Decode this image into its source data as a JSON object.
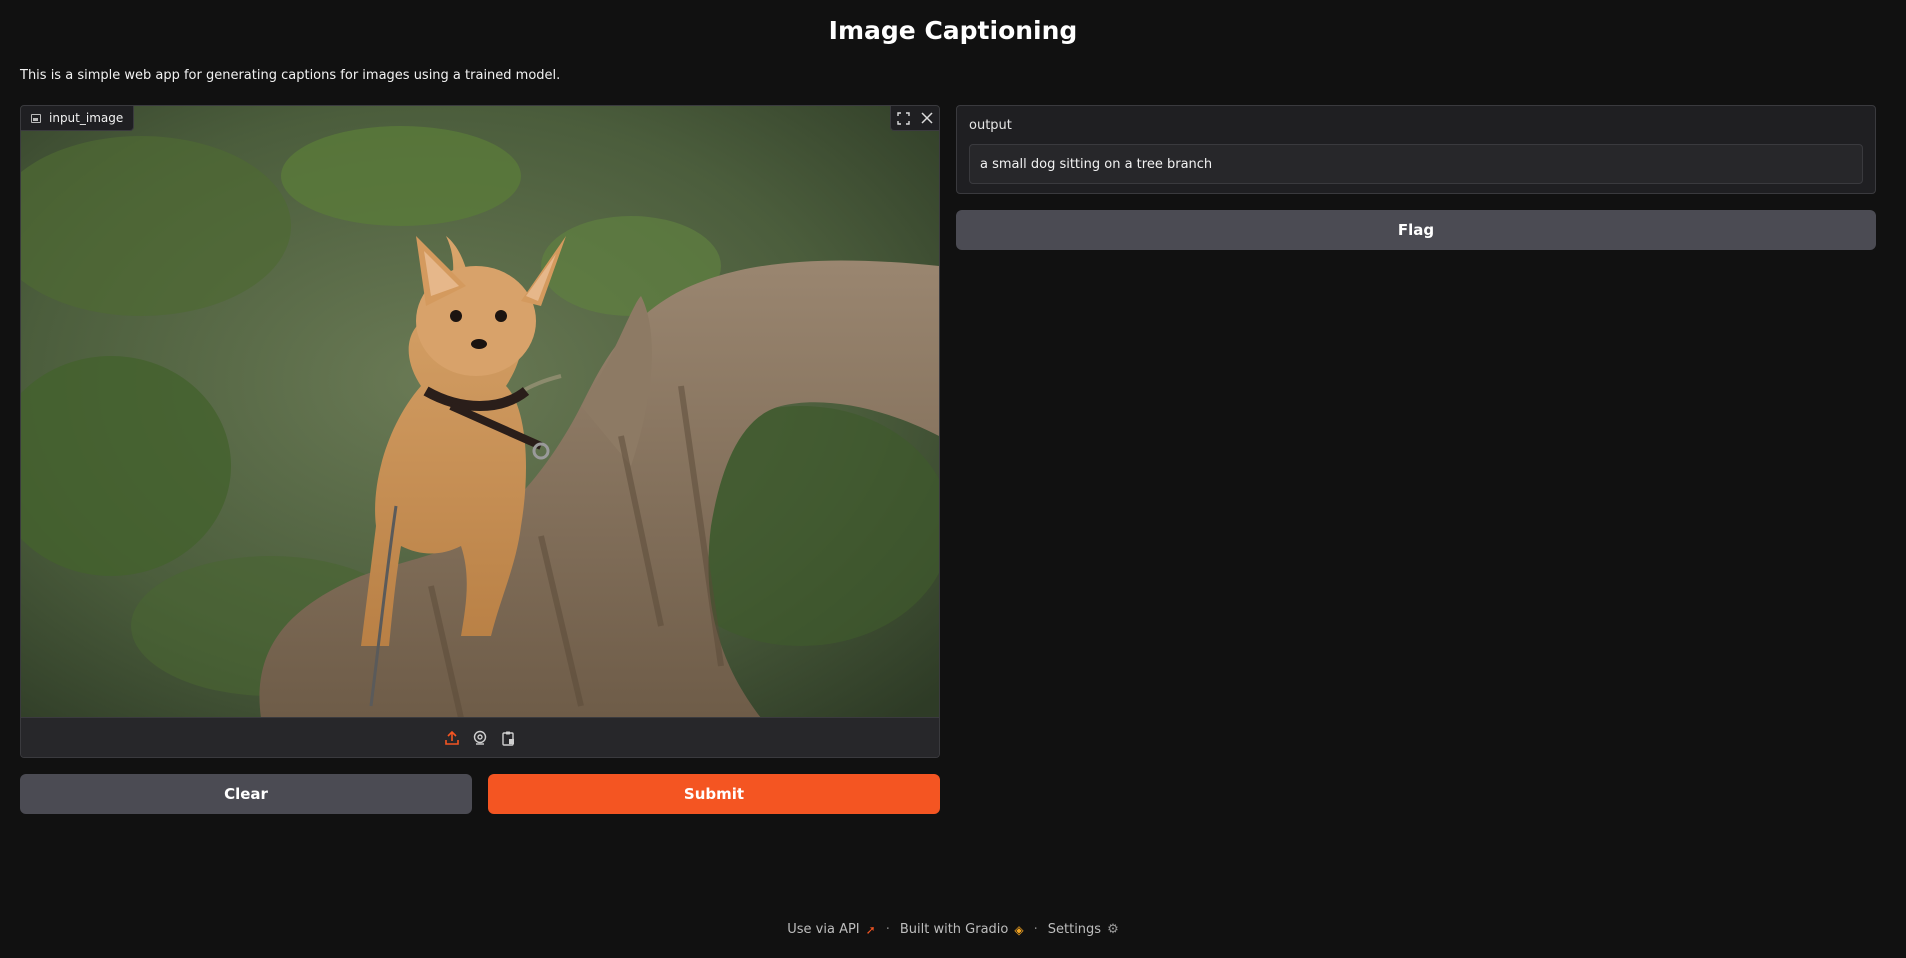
{
  "header": {
    "title": "Image Captioning",
    "description": "This is a simple web app for generating captions for images using a trained model."
  },
  "input_image": {
    "label": "input_image",
    "fullscreen_icon": "fullscreen-icon",
    "close_icon": "close-icon",
    "photo_subject": "small dog on tree stump",
    "sources": [
      "upload-icon",
      "webcam-icon",
      "clipboard-icon"
    ]
  },
  "buttons": {
    "clear_label": "Clear",
    "submit_label": "Submit",
    "flag_label": "Flag"
  },
  "output": {
    "label": "output",
    "value": "a small dog sitting on a tree branch"
  },
  "footer": {
    "api_label": "Use via API",
    "built_label": "Built with Gradio",
    "settings_label": "Settings"
  },
  "colors": {
    "accent": "#f45522",
    "background": "#111111",
    "panel": "#1f1f22",
    "secondary_button": "#4b4b53"
  }
}
